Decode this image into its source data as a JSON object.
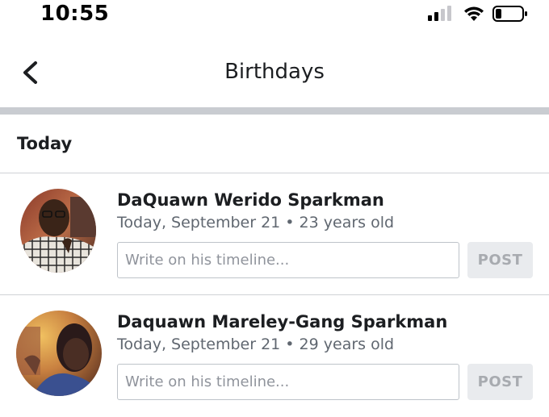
{
  "status_bar": {
    "time": "10:55",
    "icons": [
      "signal-icon",
      "wifi-icon",
      "battery-icon"
    ]
  },
  "nav": {
    "back_icon": "chevron-left-icon",
    "title": "Birthdays"
  },
  "section": {
    "title": "Today"
  },
  "people": [
    {
      "name": "DaQuawn Werido Sparkman",
      "meta": "Today, September 21 • 23 years old",
      "input_placeholder": "Write on his timeline...",
      "post_label": "POST"
    },
    {
      "name": "Daquawn Mareley-Gang Sparkman",
      "meta": "Today, September 21 • 29 years old",
      "input_placeholder": "Write on his timeline...",
      "post_label": "POST"
    }
  ],
  "colors": {
    "accent_gray": "#c9ccd1",
    "post_button_bg": "#e9ebee",
    "post_button_text": "#a8abb0",
    "meta_text": "#606770"
  }
}
